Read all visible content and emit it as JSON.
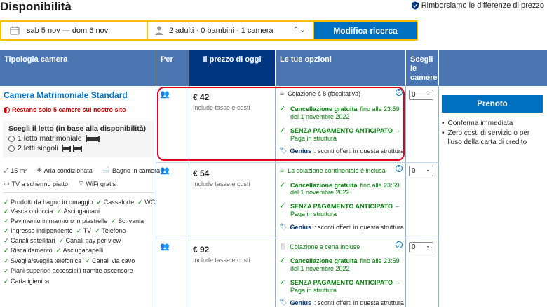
{
  "title": "Disponibilità",
  "refund_note": "Rimborsiamo le differenze di prezzo",
  "search": {
    "dates": "sab 5 nov — dom 6 nov",
    "guests": "2 adulti · 0 bambini · 1 camera",
    "button": "Modifica ricerca"
  },
  "headers": {
    "room_type": "Tipologia camera",
    "per": "Per",
    "price_today": "Il prezzo di oggi",
    "options": "Le tue opzioni",
    "choose_rooms": "Scegli le camere"
  },
  "room": {
    "name": "Camera Matrimoniale Standard",
    "scarcity": "Restano solo 5 camere sul nostro sito",
    "bed_title": "Scegli il letto (in base alla disponibilità)",
    "bed_options": [
      "1 letto matrimoniale",
      "2 letti singoli"
    ],
    "facilities_row1": [
      "15 m²",
      "Aria condizionata",
      "Bagno in camera"
    ],
    "facilities_row2": [
      "TV a schermo piatto",
      "WiFi gratis"
    ],
    "amenities": [
      [
        "Prodotti da bagno in omaggio",
        "Cassaforte",
        "WC"
      ],
      [
        "Vasca o doccia",
        "Asciugamani"
      ],
      [
        "Pavimento in marmo o in piastrelle",
        "Scrivania"
      ],
      [
        "Ingresso indipendente",
        "TV",
        "Telefono"
      ],
      [
        "Canali satellitari",
        "Canali pay per view"
      ],
      [
        "Riscaldamento",
        "Asciugacapelli"
      ],
      [
        "Sveglia/sveglia telefonica",
        "Canali via cavo"
      ],
      [
        "Piani superiori accessibili tramite ascensore"
      ],
      [
        "Carta igienica"
      ]
    ]
  },
  "rates": [
    {
      "persons": "2",
      "price": "€ 42",
      "taxes": "Include tasse e costi",
      "meal": "Colazione € 8 (facoltativa)",
      "cancel_bold": "Cancellazione gratuita",
      "cancel_rest": "fino alle 23:59",
      "cancel_date": "del 1 novembre 2022",
      "nopay_bold": "SENZA PAGAMENTO ANTICIPATO",
      "nopay_rest": "–",
      "nopay_sub": "Paga in struttura",
      "genius_label": "Genius",
      "genius_text": ": sconti offerti in questa struttura",
      "qty": "0"
    },
    {
      "persons": "2",
      "price": "€ 54",
      "taxes": "Include tasse e costi",
      "meal": "La colazione continentale è inclusa",
      "cancel_bold": "Cancellazione gratuita",
      "cancel_rest": "fino alle 23:59",
      "cancel_date": "del 1 novembre 2022",
      "nopay_bold": "SENZA PAGAMENTO ANTICIPATO",
      "nopay_rest": "–",
      "nopay_sub": "Paga in struttura",
      "genius_label": "Genius",
      "genius_text": ": sconti offerti in questa struttura",
      "qty": "0"
    },
    {
      "persons": "2",
      "price": "€ 92",
      "taxes": "Include tasse e costi",
      "meal": "Colazione e cena incluse",
      "cancel_bold": "Cancellazione gratuita",
      "cancel_rest": "fino alle 23:59",
      "cancel_date": "del 1 novembre 2022",
      "nopay_bold": "SENZA PAGAMENTO ANTICIPATO",
      "nopay_rest": "–",
      "nopay_sub": "Paga in struttura",
      "genius_label": "Genius",
      "genius_text": ": sconti offerti in questa struttura",
      "qty": "0"
    }
  ],
  "booking": {
    "button": "Prenoto",
    "bullets": [
      "Conferma immediata",
      "Zero costi di servizio o per l'uso della carta di credito"
    ]
  },
  "colors": {
    "brand_blue": "#003580",
    "header_blue": "#4c76b2",
    "action_blue": "#0071c2",
    "accent_yellow": "#febb02",
    "green": "#008009",
    "alert_red": "#cc0000",
    "highlight_red": "#e0001b"
  }
}
